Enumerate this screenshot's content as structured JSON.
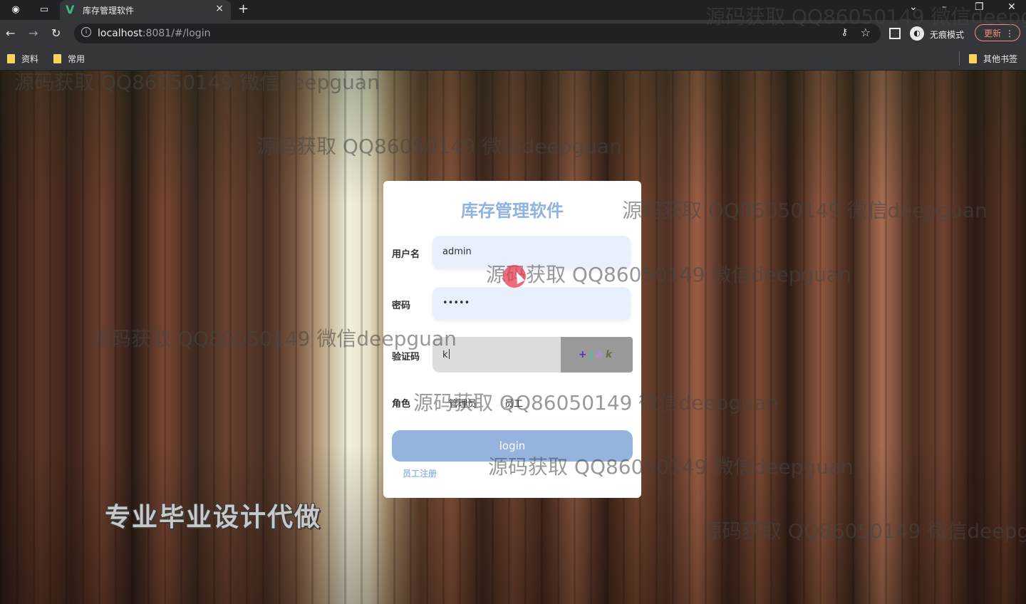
{
  "browser": {
    "tab_title": "库存管理软件",
    "tab_close": "×",
    "new_tab": "+",
    "url_host": "localhost",
    "url_rest": ":8081/#/login",
    "incognito_label": "无痕模式",
    "update_label": "更新",
    "bookmarks": [
      "资料",
      "常用"
    ],
    "other_bookmarks": "其他书签"
  },
  "login": {
    "title": "库存管理软件",
    "username_label": "用户名",
    "username_value": "admin",
    "password_label": "密码",
    "password_value": "•••••",
    "code_label": "验证码",
    "code_value": "k",
    "captcha_chars": [
      "+",
      "j",
      "a",
      "k"
    ],
    "role_label": "角色",
    "role_options": [
      "管理员",
      "员工"
    ],
    "login_button": "login",
    "register_link": "员工注册"
  },
  "overlays": {
    "watermark_text": "源码获取 QQ86050149 微信deepguan",
    "banner_text": "专业毕业设计代做"
  },
  "colors": {
    "title": "#8fb3e0",
    "login_button": "#94b3dd",
    "register_link": "#9cbbe3",
    "field_bg": "#e8f0fe"
  }
}
